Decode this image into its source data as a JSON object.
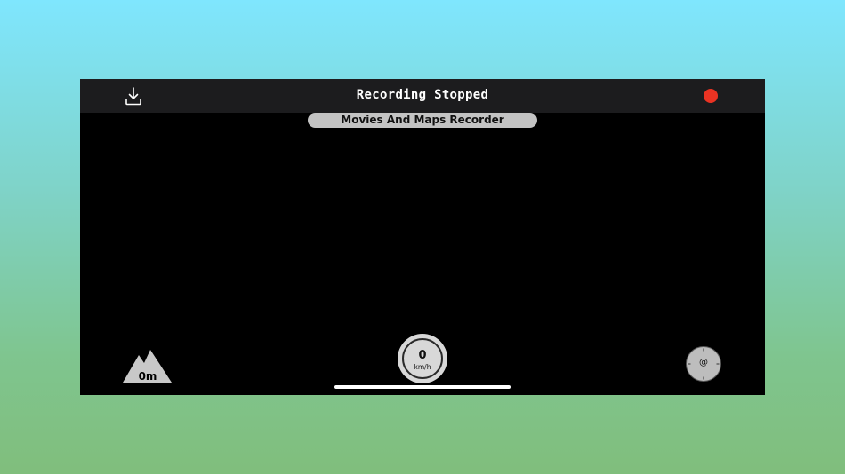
{
  "header": {
    "title": "Recording Stopped",
    "download_icon": "download-icon",
    "record_icon": "record-dot-icon",
    "record_color": "#ea3323"
  },
  "app_name": "Movies And Maps Recorder",
  "altitude": {
    "icon": "mountain-icon",
    "value": "0m"
  },
  "speed": {
    "value": "0",
    "unit": "km/h"
  },
  "compass": {
    "icon": "compass-icon",
    "label": "@"
  }
}
